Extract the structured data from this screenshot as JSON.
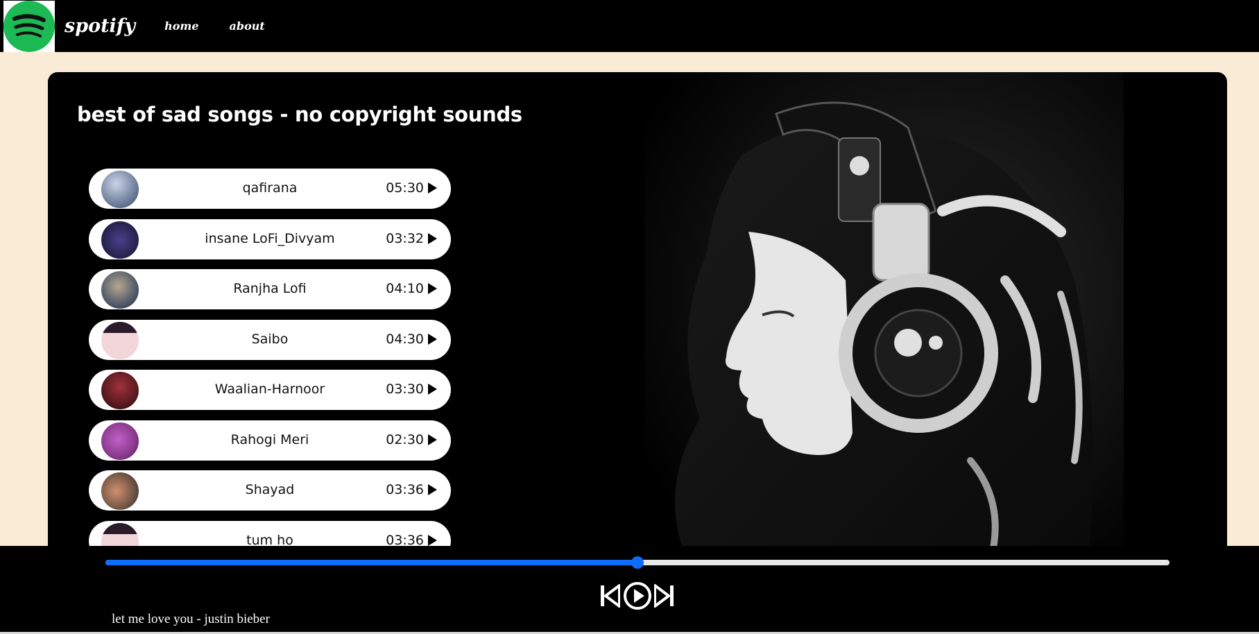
{
  "navbar": {
    "brand": "spotify",
    "links": [
      "home",
      "about"
    ]
  },
  "playlist": {
    "title": "best of sad songs - no copyright sounds",
    "songs": [
      {
        "name": "qafirana",
        "duration": "05:30",
        "thumb_color": "#6f7f9c"
      },
      {
        "name": "insane LoFi_Divyam",
        "duration": "03:32",
        "thumb_color": "#24204a"
      },
      {
        "name": "Ranjha Lofi",
        "duration": "04:10",
        "thumb_color": "#4a5566"
      },
      {
        "name": "Saibo",
        "duration": "04:30",
        "thumb_color": "#e9c2c8"
      },
      {
        "name": "Waalian-Harnoor",
        "duration": "03:30",
        "thumb_color": "#5a1a20"
      },
      {
        "name": "Rahogi Meri",
        "duration": "02:30",
        "thumb_color": "#8a3a8c"
      },
      {
        "name": "Shayad",
        "duration": "03:36",
        "thumb_color": "#7a5a48"
      },
      {
        "name": "tum ho",
        "duration": "03:36",
        "thumb_color": "#e9c2c8"
      }
    ]
  },
  "player": {
    "now_playing": "let me love you - justin bieber",
    "progress": 0.5,
    "accent_color": "#0d6efd"
  }
}
